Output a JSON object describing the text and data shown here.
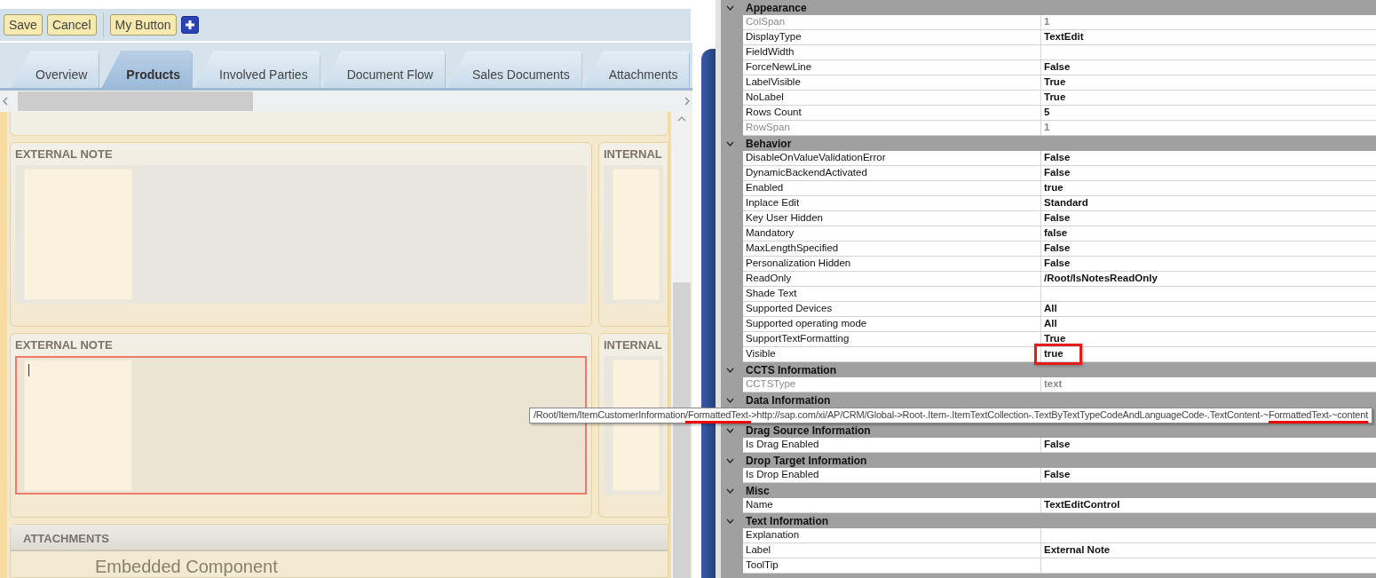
{
  "toolbar": {
    "buttons": [
      {
        "kind": "text",
        "label": "Save"
      },
      {
        "kind": "text",
        "label": "Cancel"
      },
      {
        "kind": "separator"
      },
      {
        "kind": "text",
        "label": "My Button"
      },
      {
        "kind": "add"
      }
    ]
  },
  "tabs": [
    {
      "label": "Overview",
      "selected": false
    },
    {
      "label": "Products",
      "selected": true
    },
    {
      "label": "Involved Parties",
      "selected": false
    },
    {
      "label": "Document Flow",
      "selected": false
    },
    {
      "label": "Sales Documents",
      "selected": false
    },
    {
      "label": "Attachments",
      "selected": false
    }
  ],
  "note_rows": [
    {
      "cards": [
        {
          "title": "EXTERNAL NOTE",
          "focused": false
        },
        {
          "title": "INTERNAL",
          "focused": false
        }
      ]
    },
    {
      "cards": [
        {
          "title": "EXTERNAL NOTE",
          "focused": true
        },
        {
          "title": "INTERNAL",
          "focused": false
        }
      ]
    }
  ],
  "attachments": {
    "title": "ATTACHMENTS",
    "content": "Embedded Component"
  },
  "properties": [
    {
      "name": "Appearance",
      "expanded": true,
      "rows": [
        {
          "name": "ColSpan",
          "value": "1",
          "disabled": true,
          "highlighted": false
        },
        {
          "name": "DisplayType",
          "value": "TextEdit",
          "disabled": false,
          "highlighted": false
        },
        {
          "name": "FieldWidth",
          "disabled": false,
          "highlighted": false
        },
        {
          "name": "ForceNewLine",
          "value": "False",
          "disabled": false,
          "highlighted": false
        },
        {
          "name": "LabelVisible",
          "value": "True",
          "disabled": false,
          "highlighted": false
        },
        {
          "name": "NoLabel",
          "value": "True",
          "disabled": false,
          "highlighted": false
        },
        {
          "name": "Rows Count",
          "value": "5",
          "disabled": false,
          "highlighted": false
        },
        {
          "name": "RowSpan",
          "value": "1",
          "disabled": true,
          "highlighted": false
        }
      ]
    },
    {
      "name": "Behavior",
      "expanded": true,
      "rows": [
        {
          "name": "DisableOnValueValidationError",
          "value": "False",
          "disabled": false,
          "highlighted": false
        },
        {
          "name": "DynamicBackendActivated",
          "value": "False",
          "disabled": false,
          "highlighted": false
        },
        {
          "name": "Enabled",
          "value": "true",
          "disabled": false,
          "highlighted": false
        },
        {
          "name": "Inplace Edit",
          "value": "Standard",
          "disabled": false,
          "highlighted": false
        },
        {
          "name": "Key User Hidden",
          "value": "False",
          "disabled": false,
          "highlighted": false
        },
        {
          "name": "Mandatory",
          "value": "false",
          "disabled": false,
          "highlighted": false
        },
        {
          "name": "MaxLengthSpecified",
          "value": "False",
          "disabled": false,
          "highlighted": false
        },
        {
          "name": "Personalization Hidden",
          "value": "False",
          "disabled": false,
          "highlighted": false
        },
        {
          "name": "ReadOnly",
          "value": "/Root/IsNotesReadOnly",
          "disabled": false,
          "highlighted": false
        },
        {
          "name": "Shade Text",
          "disabled": false,
          "highlighted": false
        },
        {
          "name": "Supported Devices",
          "value": "All",
          "disabled": false,
          "highlighted": false
        },
        {
          "name": "Supported operating mode",
          "value": "All",
          "disabled": false,
          "highlighted": false
        },
        {
          "name": "SupportTextFormatting",
          "value": "True",
          "disabled": false,
          "highlighted": false
        },
        {
          "name": "Visible",
          "value": "true",
          "disabled": false,
          "highlighted": true
        }
      ]
    },
    {
      "name": "CCTS Information",
      "expanded": true,
      "rows": [
        {
          "name": "CCTSType",
          "value": "text",
          "disabled": true,
          "highlighted": false
        }
      ]
    },
    {
      "name": "Data Information",
      "expanded": true,
      "tooltip": {
        "segments": [
          {
            "text": "/Root/Item/ItemCustomerInformation",
            "underlined": false
          },
          {
            "text": "/FormattedText-",
            "underlined": true
          },
          {
            "text": ">http://sap.com/xi/AP/CRM/Global->Root-.Item-.ItemTextCollection-.TextByTextTypeCodeAndLanguageCode-.TextContent-~",
            "underlined": false
          },
          {
            "text": "FormattedText-~content",
            "underlined": true
          }
        ]
      }
    },
    {
      "name": "Drag Source Information",
      "expanded": true,
      "rows": [
        {
          "name": "Is Drag Enabled",
          "value": "False",
          "disabled": false,
          "highlighted": false
        }
      ]
    },
    {
      "name": "Drop Target Information",
      "expanded": true,
      "rows": [
        {
          "name": "Is Drop Enabled",
          "value": "False",
          "disabled": false,
          "highlighted": false
        }
      ]
    },
    {
      "name": "Misc",
      "expanded": true,
      "rows": [
        {
          "name": "Name",
          "value": "TextEditControl",
          "disabled": false,
          "highlighted": false
        }
      ]
    },
    {
      "name": "Text Information",
      "expanded": true,
      "rows": [
        {
          "name": "Explanation",
          "disabled": false,
          "highlighted": false
        },
        {
          "name": "Label",
          "value": "External Note",
          "disabled": false,
          "highlighted": false
        },
        {
          "name": "ToolTip",
          "disabled": false,
          "highlighted": false
        }
      ]
    }
  ]
}
